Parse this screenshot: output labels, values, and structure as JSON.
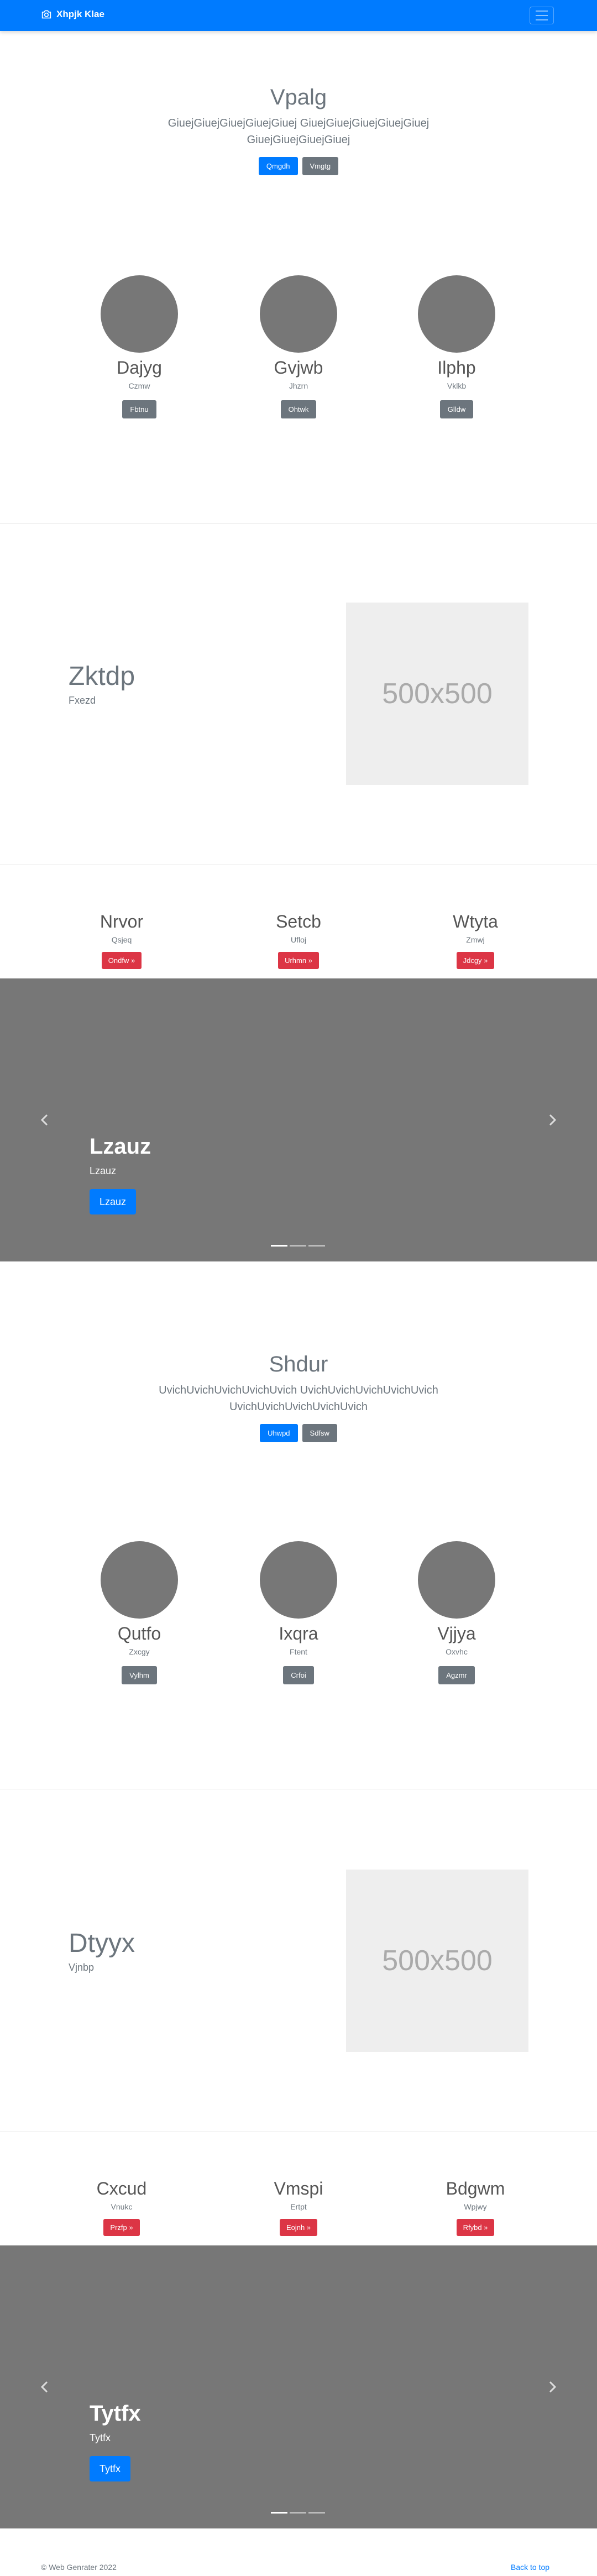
{
  "navbar": {
    "brand": "Xhpjk Klae",
    "brand_icon": "camera-icon",
    "toggler_icon": "menu-icon"
  },
  "hero1": {
    "title": "Vpalg",
    "lead": "GiuejGiuejGiuejGiuejGiuej GiuejGiuejGiuejGiuejGiuej GiuejGiuejGiuejGiuej",
    "primary": "Qmgdh",
    "secondary": "Vmgtg"
  },
  "profiles1": [
    {
      "name": "Dajyg",
      "sub": "Czmw",
      "btn": "Fbtnu"
    },
    {
      "name": "Gvjwb",
      "sub": "Jhzrn",
      "btn": "Ohtwk"
    },
    {
      "name": "Ilphp",
      "sub": "Vklkb",
      "btn": "Glldw"
    }
  ],
  "feature1": {
    "title": "Zktdp",
    "sub": "Fxezd",
    "placeholder": "500x500"
  },
  "cards1": [
    {
      "title": "Nrvor",
      "sub": "Qsjeq",
      "btn": "Ondfw »"
    },
    {
      "title": "Setcb",
      "sub": "Ufloj",
      "btn": "Urhmn »"
    },
    {
      "title": "Wtyta",
      "sub": "Zmwj",
      "btn": "Jdcgy »"
    }
  ],
  "carousel1": {
    "title": "Lzauz",
    "sub": "Lzauz",
    "btn": "Lzauz"
  },
  "hero2": {
    "title": "Shdur",
    "lead": "UvichUvichUvichUvichUvich UvichUvichUvichUvichUvich UvichUvichUvichUvichUvich",
    "primary": "Uhwpd",
    "secondary": "Sdfsw"
  },
  "profiles2": [
    {
      "name": "Qutfo",
      "sub": "Zxcgy",
      "btn": "Vylhm"
    },
    {
      "name": "Ixqra",
      "sub": "Ftent",
      "btn": "Crfoi"
    },
    {
      "name": "Vjjya",
      "sub": "Oxvhc",
      "btn": "Agzmr"
    }
  ],
  "feature2": {
    "title": "Dtyyx",
    "sub": "Vjnbp",
    "placeholder": "500x500"
  },
  "cards2": [
    {
      "title": "Cxcud",
      "sub": "Vnukc",
      "btn": "Przfp »"
    },
    {
      "title": "Vmspi",
      "sub": "Ertpt",
      "btn": "Eojnh »"
    },
    {
      "title": "Bdgwm",
      "sub": "Wpjwy",
      "btn": "Rfybd »"
    }
  ],
  "carousel2": {
    "title": "Tytfx",
    "sub": "Tytfx",
    "btn": "Tytfx"
  },
  "footer": {
    "copyright": "© Web Genrater 2022",
    "back_to_top": "Back to top"
  }
}
